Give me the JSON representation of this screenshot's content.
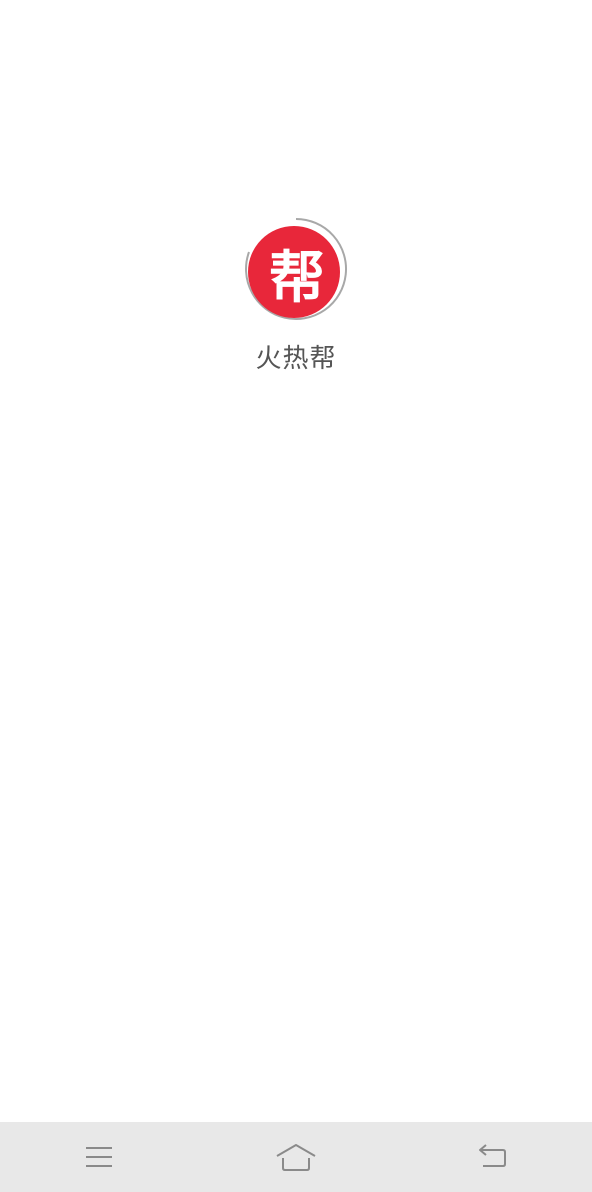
{
  "splash": {
    "logo_glyph": "帮",
    "app_name": "火热帮",
    "logo_color": "#e8273a"
  },
  "navbar": {
    "buttons": [
      {
        "icon": "menu-icon"
      },
      {
        "icon": "home-icon"
      },
      {
        "icon": "back-icon"
      }
    ]
  }
}
